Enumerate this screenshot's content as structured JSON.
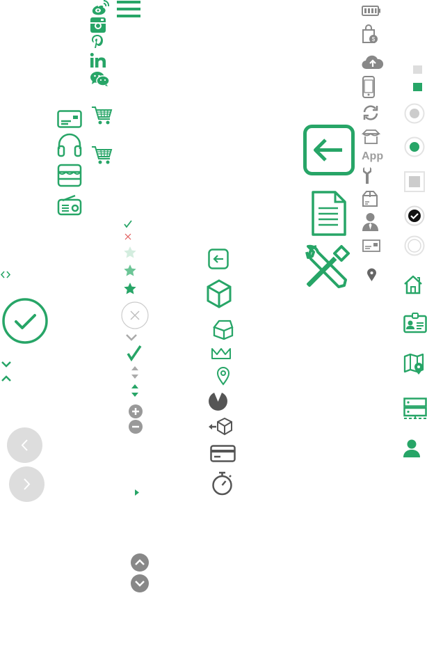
{
  "colors": {
    "accent": "#27a567",
    "gray": "#999999",
    "light_gray": "#dddddd",
    "dark_gray": "#555555"
  },
  "labels": {
    "app": "App"
  },
  "icons": [
    "weibo-icon",
    "instagram-icon",
    "pinterest-icon",
    "linkedin-icon",
    "wechat-icon",
    "hamburger-menu-icon",
    "shopping-cart-icon",
    "id-card-icon",
    "headphones-icon",
    "store-icon",
    "radio-icon",
    "battery-icon",
    "shopping-bag-icon",
    "cloud-upload-icon",
    "smartphone-icon",
    "refresh-icon",
    "pavilion-icon",
    "wrench-icon",
    "package-box-icon",
    "user-silhouette-icon",
    "id-card-icon",
    "map-pin-icon",
    "back-arrow-large-icon",
    "document-icon",
    "tools-icon",
    "check-circle-icon",
    "close-circle-icon",
    "star-icon",
    "chevron-left-button-icon",
    "chevron-right-button-icon",
    "cube-icon",
    "crown-icon",
    "location-pin-icon",
    "pie-chart-icon",
    "return-package-icon",
    "credit-card-icon",
    "stopwatch-icon",
    "radio-button-icon",
    "checkbox-icon",
    "home-icon",
    "badge-icon",
    "map-icon",
    "server-icon",
    "user-icon"
  ]
}
